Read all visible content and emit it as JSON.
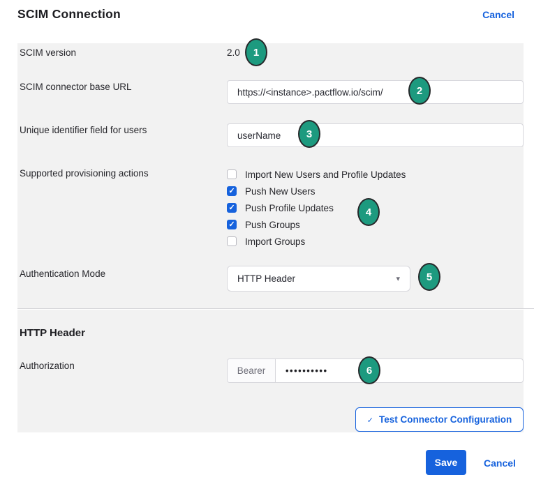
{
  "header": {
    "title": "SCIM Connection",
    "cancel_label": "Cancel"
  },
  "colors": {
    "accent_blue": "#1662dd",
    "badge_green": "#1d9a7f",
    "panel_gray": "#f2f2f2",
    "input_border": "#d7d7dc"
  },
  "fields": {
    "scim_version": {
      "label": "SCIM version",
      "value": "2.0",
      "badge": "1"
    },
    "base_url": {
      "label": "SCIM connector base URL",
      "value": "https://<instance>.pactflow.io/scim/",
      "badge": "2"
    },
    "unique_identifier": {
      "label": "Unique identifier field for users",
      "value": "userName",
      "badge": "3"
    },
    "provisioning": {
      "label": "Supported provisioning actions",
      "badge": "4",
      "options": [
        {
          "label": "Import New Users and Profile Updates",
          "checked": false
        },
        {
          "label": "Push New Users",
          "checked": true
        },
        {
          "label": "Push Profile Updates",
          "checked": true
        },
        {
          "label": "Push Groups",
          "checked": true
        },
        {
          "label": "Import Groups",
          "checked": false
        }
      ]
    },
    "auth_mode": {
      "label": "Authentication Mode",
      "value": "HTTP Header",
      "badge": "5",
      "caret_icon": "▾"
    },
    "authorization": {
      "label": "Authorization",
      "prefix": "Bearer",
      "masked_value": "••••••••••",
      "badge": "6"
    }
  },
  "section": {
    "title": "HTTP Header"
  },
  "test_button": {
    "label": "Test Connector Configuration",
    "icon": "✓"
  },
  "footer": {
    "save_label": "Save",
    "cancel_label": "Cancel"
  }
}
